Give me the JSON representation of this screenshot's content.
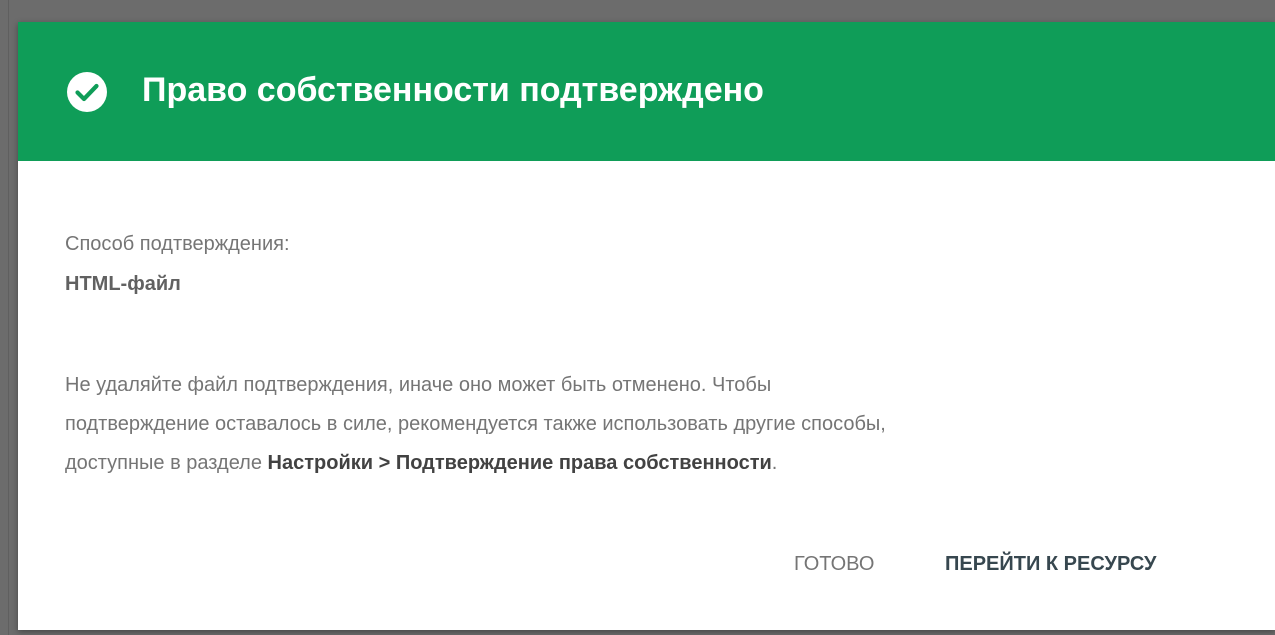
{
  "dialog": {
    "title": "Право собственности подтверждено",
    "header_color": "#0f9d58",
    "header_icon": "check-circle-icon",
    "method_label": "Способ подтверждения:",
    "method_value": "HTML-файл",
    "notice": {
      "line1": "Не удаляйте файл подтверждения, иначе оно может быть отменено. Чтобы",
      "line2": "подтверждение оставалось в силе, рекомендуется также использовать другие способы,",
      "line3_prefix": "доступные в разделе ",
      "line3_bold": "Настройки > Подтверждение права собственности",
      "line3_suffix": "."
    },
    "buttons": {
      "done_label": "ГОТОВО",
      "go_label": "ПЕРЕЙТИ К РЕСУРСУ"
    }
  }
}
